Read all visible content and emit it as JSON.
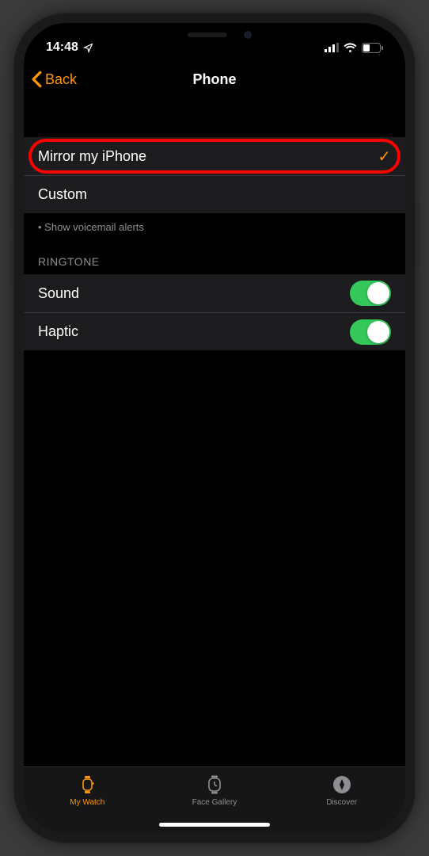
{
  "status": {
    "time": "14:48",
    "location_icon": "location-arrow"
  },
  "nav": {
    "back_label": "Back",
    "title": "Phone"
  },
  "alerts": {
    "options": [
      {
        "label": "Mirror my iPhone",
        "selected": true,
        "highlighted": true
      },
      {
        "label": "Custom",
        "selected": false,
        "highlighted": false
      }
    ],
    "footer": "• Show voicemail alerts"
  },
  "ringtone": {
    "header": "RINGTONE",
    "rows": [
      {
        "label": "Sound",
        "on": true
      },
      {
        "label": "Haptic",
        "on": true
      }
    ]
  },
  "tabs": [
    {
      "label": "My Watch",
      "icon": "watch-side",
      "active": true
    },
    {
      "label": "Face Gallery",
      "icon": "watch-face",
      "active": false
    },
    {
      "label": "Discover",
      "icon": "compass",
      "active": false
    }
  ]
}
